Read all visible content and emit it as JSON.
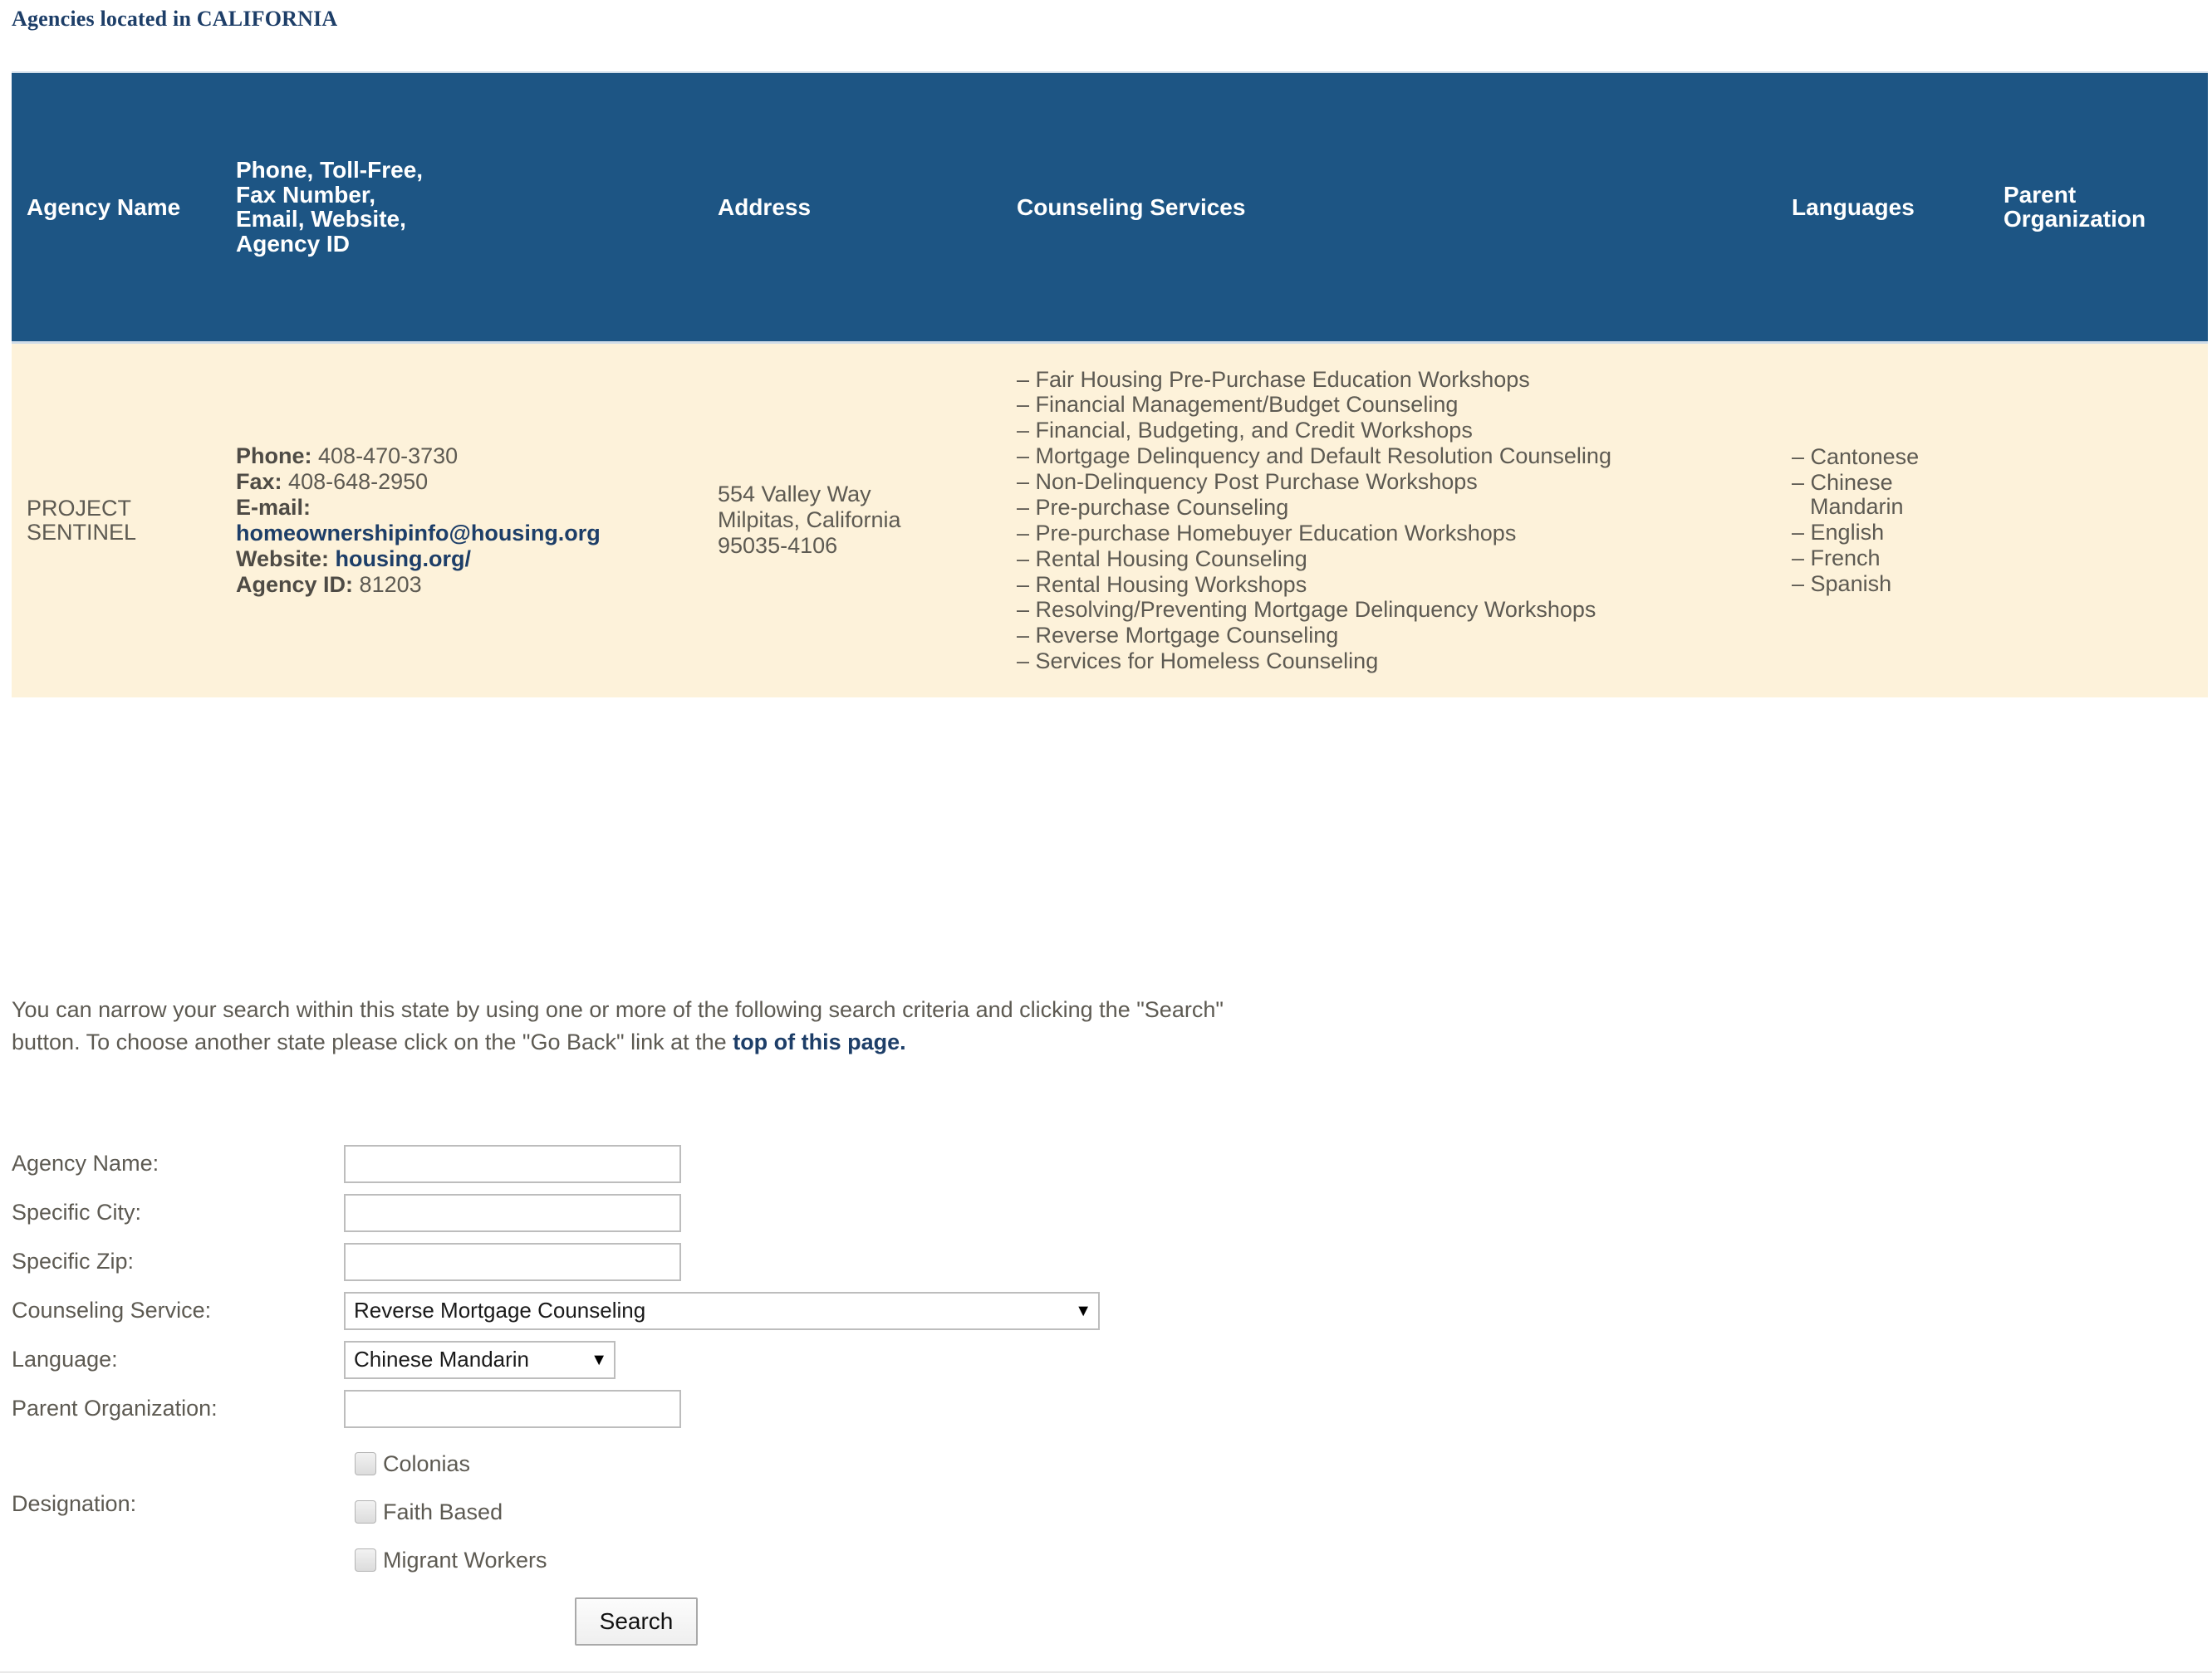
{
  "page_title": "Agencies located in CALIFORNIA",
  "colors": {
    "header_blue": "#1d5584",
    "row_cream": "#fdf2da",
    "link_navy": "#1d3e68",
    "body_text": "#5d5a52"
  },
  "table": {
    "headers": {
      "agency_name": "Agency Name",
      "contact": "Phone, Toll-Free, Fax Number, Email, Website, Agency ID",
      "contact_lines": [
        "Phone, Toll-Free,",
        "Fax Number,",
        "Email, Website,",
        "Agency ID"
      ],
      "address": "Address",
      "counseling_services": "Counseling Services",
      "languages": "Languages",
      "parent_organization_lines": [
        "Parent",
        "Organization"
      ],
      "parent_organization": "Parent Organization"
    },
    "rows": [
      {
        "agency_name_lines": [
          "PROJECT",
          "SENTINEL"
        ],
        "agency_name": "PROJECT SENTINEL",
        "contact": {
          "phone_label": "Phone:",
          "phone": "408-470-3730",
          "fax_label": "Fax:",
          "fax": "408-648-2950",
          "email_label": "E-mail:",
          "email": "homeownershipinfo@housing.org",
          "website_label": "Website:",
          "website": "housing.org/",
          "agency_id_label": "Agency ID:",
          "agency_id": "81203"
        },
        "address_lines": [
          "554 Valley Way",
          "Milpitas, California",
          "95035-4106"
        ],
        "counseling_services": [
          "Fair Housing Pre-Purchase Education Workshops",
          "Financial Management/Budget Counseling",
          "Financial, Budgeting, and Credit Workshops",
          "Mortgage Delinquency and Default Resolution Counseling",
          "Non-Delinquency Post Purchase Workshops",
          "Pre-purchase Counseling",
          "Pre-purchase Homebuyer Education Workshops",
          "Rental Housing Counseling",
          "Rental Housing Workshops",
          "Resolving/Preventing Mortgage Delinquency Workshops",
          "Reverse Mortgage Counseling",
          "Services for Homeless Counseling"
        ],
        "languages": [
          "Cantonese",
          "Chinese Mandarin",
          "English",
          "French",
          "Spanish"
        ],
        "parent_organization": ""
      }
    ]
  },
  "instructions": {
    "text_before_link": "You can narrow your search within this state by using one or more of the following search criteria and clicking the \"Search\" button. To choose another state please click on the \"Go Back\" link at the ",
    "link_text": "top of this page."
  },
  "search_form": {
    "agency_name_label": "Agency Name:",
    "agency_name_value": "",
    "specific_city_label": "Specific City:",
    "specific_city_value": "",
    "specific_zip_label": "Specific Zip:",
    "specific_zip_value": "",
    "counseling_service_label": "Counseling Service:",
    "counseling_service_value": "Reverse Mortgage Counseling",
    "language_label": "Language:",
    "language_value": "Chinese Mandarin",
    "parent_organization_label": "Parent Organization:",
    "parent_organization_value": "",
    "designation_label": "Designation:",
    "designation_options": [
      {
        "label": "Colonias",
        "checked": false
      },
      {
        "label": "Faith Based",
        "checked": false
      },
      {
        "label": "Migrant Workers",
        "checked": false
      }
    ],
    "dropdown_arrow": "▼",
    "search_button_label": "Search"
  }
}
